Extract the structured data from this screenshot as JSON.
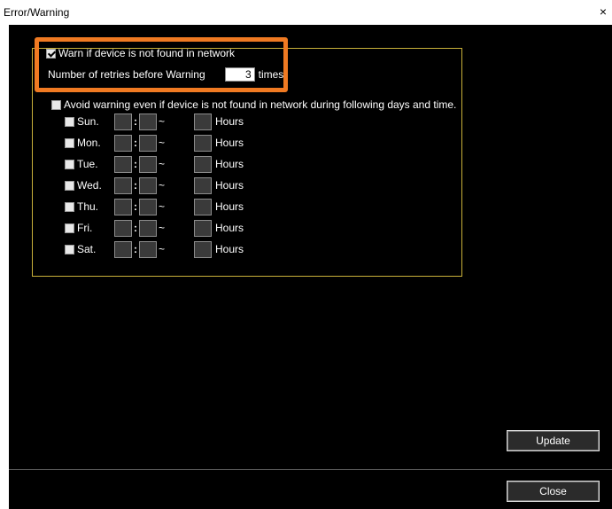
{
  "window": {
    "title": "Error/Warning",
    "close_glyph": "×"
  },
  "warn_section": {
    "warn_label": "Warn if device is not found in network",
    "warn_checked": true,
    "retries_label": "Number of retries before Warning",
    "retries_value": "3",
    "retries_unit": "times"
  },
  "avoid_section": {
    "avoid_label": "Avoid warning even if device is not found in network during following days and time.",
    "avoid_checked": false,
    "days": [
      {
        "label": "Sun."
      },
      {
        "label": "Mon."
      },
      {
        "label": "Tue."
      },
      {
        "label": "Wed."
      },
      {
        "label": "Thu."
      },
      {
        "label": "Fri."
      },
      {
        "label": "Sat."
      }
    ],
    "time_separator": ":",
    "range_separator": "~",
    "hours_label": "Hours"
  },
  "buttons": {
    "update": "Update",
    "close": "Close"
  },
  "colors": {
    "highlight": "#f07a22",
    "group_border": "#c9b13a",
    "background": "#000000"
  }
}
